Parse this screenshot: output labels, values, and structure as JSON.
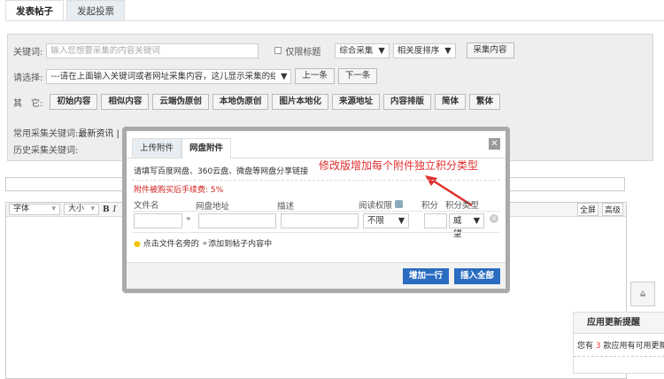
{
  "tabs": [
    "发表帖子",
    "发起投票"
  ],
  "search": {
    "keyword_label": "关键词:",
    "keyword_placeholder": "输入您想要采集的内容关键词",
    "title_only": "仅限标题",
    "mode": "综合采集",
    "sort": "相关度排序",
    "collect_button": "采集内容",
    "choose_label": "请选择:",
    "choose_value": "---请在上面输入关键词或者网址采集内容，这儿显示采集的结果---",
    "prev": "上一条",
    "next": "下一条",
    "other_label": "其　它:",
    "other_buttons": [
      "初始内容",
      "相似内容",
      "云端伪原创",
      "本地伪原创",
      "图片本地化",
      "来源地址",
      "内容排版",
      "简体",
      "繁体"
    ],
    "common_label": "常用采集关键词:",
    "common_keywords": "最新资讯 | 微信",
    "history_label": "历史采集关键词:"
  },
  "editor": {
    "font": "字体",
    "size": "大小",
    "bold": "B",
    "italic": "I",
    "fullscreen": "全屏",
    "advanced": "高级"
  },
  "dialog": {
    "tabs": [
      "上传附件",
      "网盘附件"
    ],
    "hint": "请填写百度网盘、360云盘、微盘等网盘分享链接",
    "annotation": "修改版增加每个附件独立积分类型",
    "fee": "附件被购买后手续费: 5%",
    "cols": [
      "文件名",
      "网盘地址",
      "描述",
      "阅读权限",
      "积分",
      "积分类型"
    ],
    "perm": "不限",
    "credit_type": "威望",
    "tip_pre": "点击文件名旁的",
    "tip_post": "添加到帖子内容中",
    "add_row": "增加一行",
    "insert_all": "插入全部"
  },
  "notice": {
    "title": "应用更新提醒",
    "pre": "您有",
    "count": "3",
    "post": "款应用有可用更新"
  }
}
